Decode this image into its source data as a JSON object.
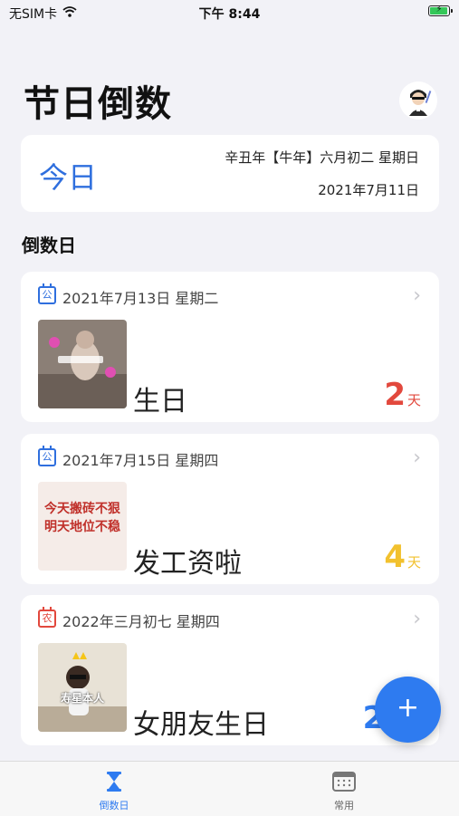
{
  "status_bar": {
    "carrier": "无SIM卡",
    "time": "下午 8:44",
    "icons": [
      "wifi-icon",
      "battery-charging-icon"
    ]
  },
  "header": {
    "title": "节日倒数",
    "avatar_icon": "avatar-icon"
  },
  "today": {
    "label": "今日",
    "lunar": "辛丑年【牛年】六月初二 星期日",
    "solar": "2021年7月11日"
  },
  "section": {
    "title": "倒数日"
  },
  "events": [
    {
      "badge": "公",
      "calendar": "solar",
      "date": "2021年7月13日 星期二",
      "name": "生日",
      "days": "2",
      "unit": "天",
      "color": "#e2483d"
    },
    {
      "badge": "公",
      "calendar": "solar",
      "date": "2021年7月15日 星期四",
      "name": "发工资啦",
      "days": "4",
      "unit": "天",
      "color": "#f2c12e",
      "thumb_text": [
        "今天搬砖不狠",
        "明天地位不稳"
      ]
    },
    {
      "badge": "农",
      "calendar": "lunar",
      "date": "2022年三月初七 星期四",
      "name": "女朋友生日",
      "days": "27",
      "unit": "天",
      "color": "#2e7bf0",
      "thumb_text": [
        "寿星本人"
      ]
    }
  ],
  "fab": {
    "label": "+"
  },
  "tabs": [
    {
      "label": "倒数日",
      "icon": "hourglass-icon",
      "active": true
    },
    {
      "label": "常用",
      "icon": "calendar-grid-icon",
      "active": false
    }
  ],
  "colors": {
    "accent": "#2e7bf0",
    "background": "#f2f2f7"
  }
}
